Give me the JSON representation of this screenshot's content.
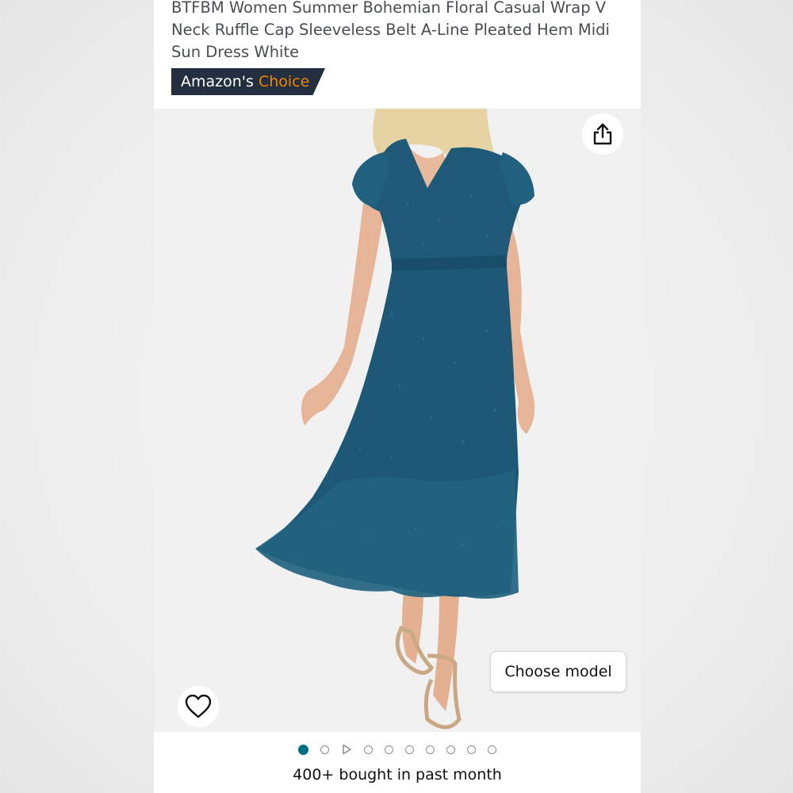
{
  "product": {
    "title": "BTFBM Women Summer Bohemian Floral Casual Wrap V Neck Ruffle Cap Sleeveless Belt A-Line Pleated Hem Midi Sun Dress White",
    "badge_prefix": "Amazon's",
    "badge_accent": "Choice"
  },
  "image": {
    "choose_model_label": "Choose model",
    "share_icon": "share-icon",
    "favorite_icon": "heart-icon",
    "dress_color": "#1e5a78"
  },
  "carousel": {
    "total_items": 10,
    "active_index": 0,
    "video_index": 2
  },
  "social_proof": {
    "bought_text": "400+ bought in past month"
  },
  "colors": {
    "badge_bg": "#232f3e",
    "badge_accent": "#f08804",
    "active_dot": "#007185"
  }
}
